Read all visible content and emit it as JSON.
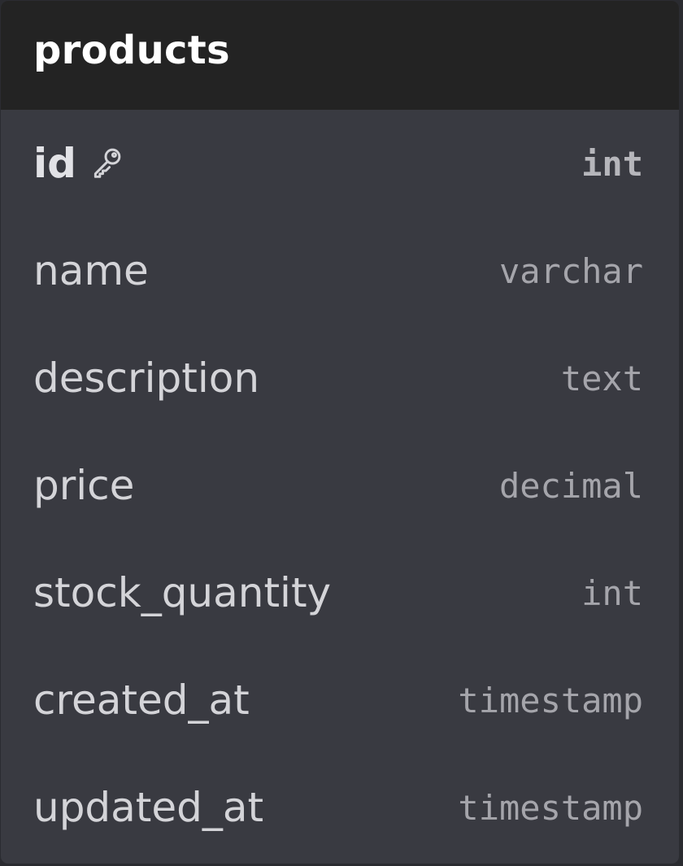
{
  "table": {
    "title": "products",
    "columns": [
      {
        "name": "id",
        "type": "int",
        "primary_key": true,
        "icon": "key-icon"
      },
      {
        "name": "name",
        "type": "varchar"
      },
      {
        "name": "description",
        "type": "text"
      },
      {
        "name": "price",
        "type": "decimal"
      },
      {
        "name": "stock_quantity",
        "type": "int"
      },
      {
        "name": "created_at",
        "type": "timestamp"
      },
      {
        "name": "updated_at",
        "type": "timestamp"
      }
    ]
  },
  "colors": {
    "header_bg": "#232323",
    "body_bg": "#393a41",
    "title_text": "#ffffff",
    "name_text": "#d4d4d8",
    "type_text": "#a5a5ab"
  }
}
